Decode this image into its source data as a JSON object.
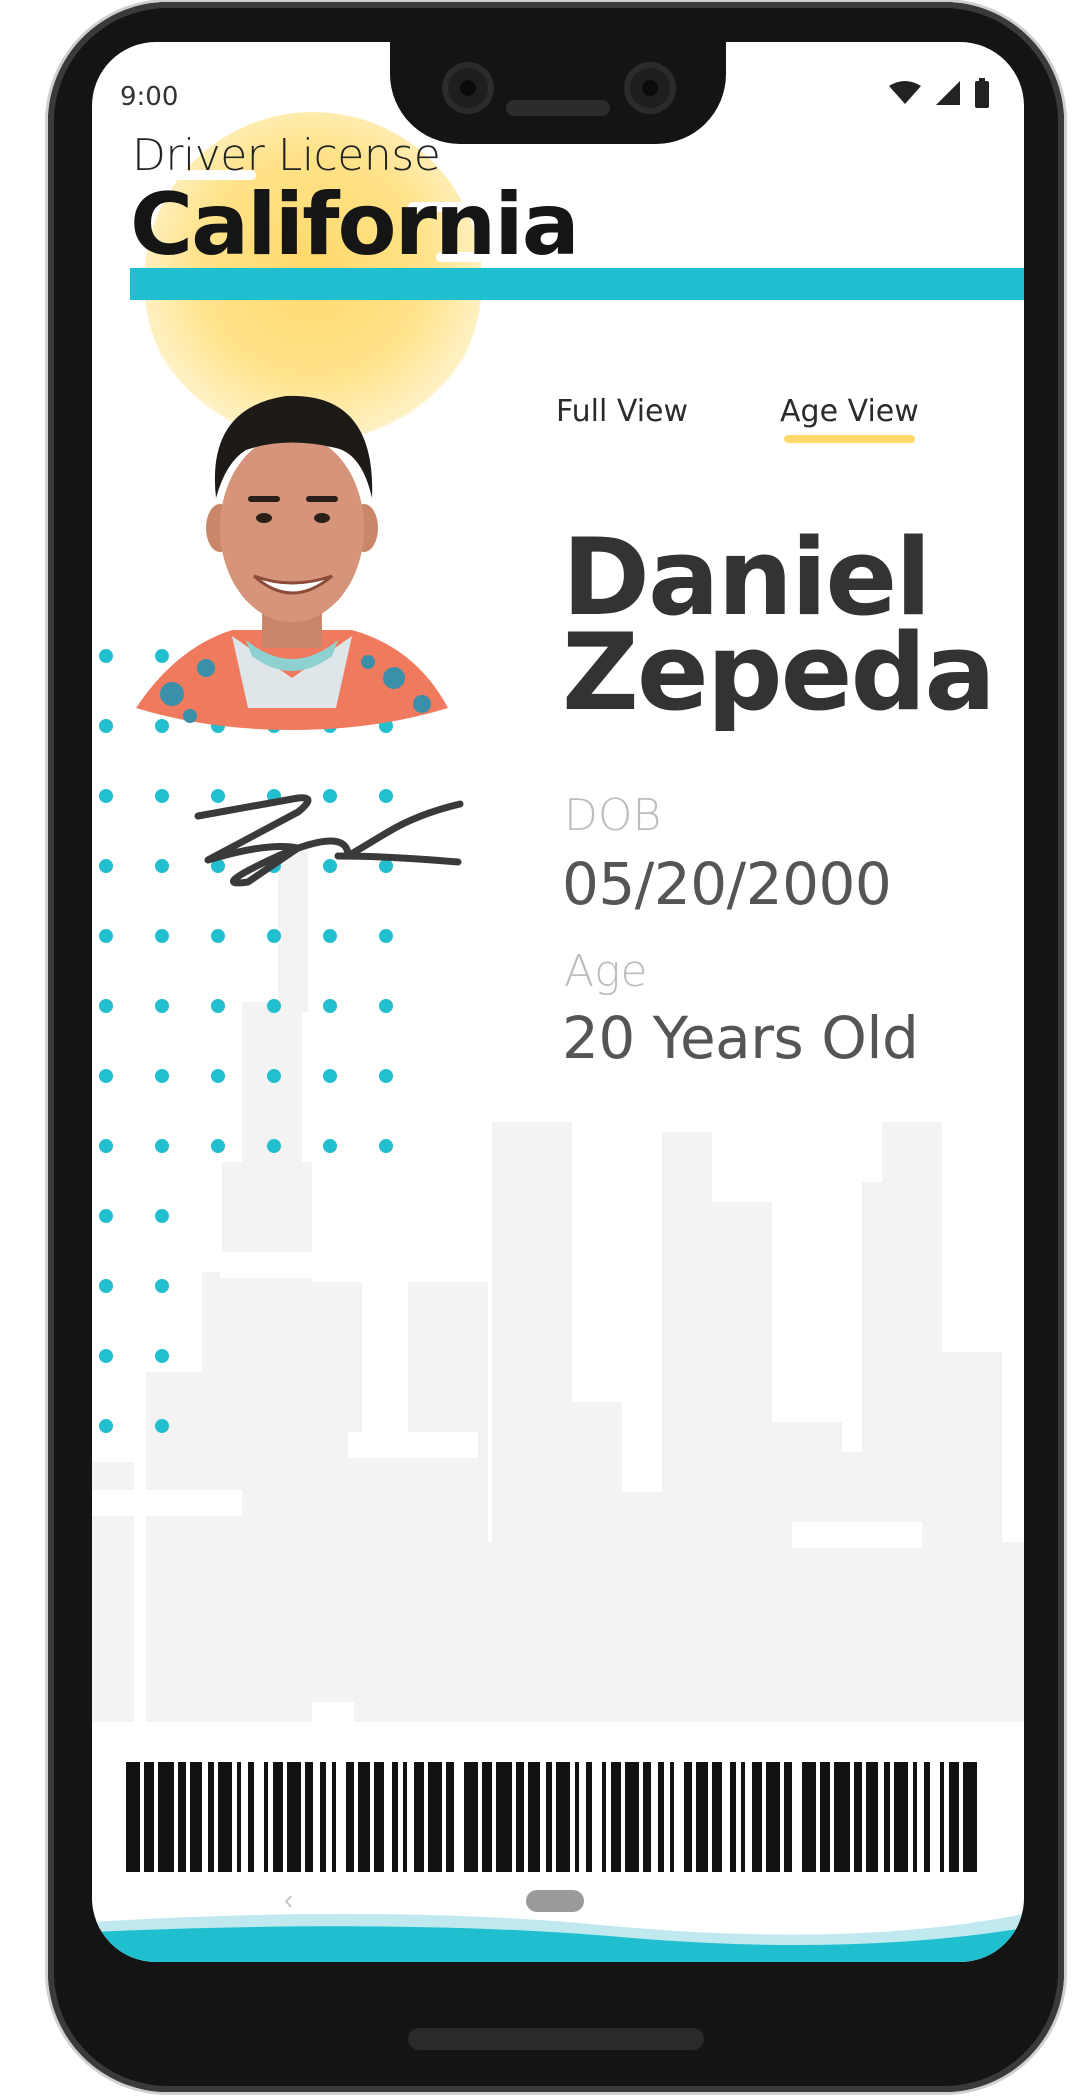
{
  "status_bar": {
    "time": "9:00"
  },
  "header": {
    "subtitle": "Driver License",
    "title": "California"
  },
  "tabs": [
    {
      "label": "Full View",
      "active": false
    },
    {
      "label": "Age View",
      "active": true
    }
  ],
  "person": {
    "first_name": "Daniel",
    "last_name": "Zepeda",
    "dob_label": "DOB",
    "dob": "05/20/2000",
    "age_label": "Age",
    "age": "20 Years Old"
  },
  "colors": {
    "accent": "#1fbfcf",
    "sun": "#ffd96b",
    "text_dark": "#333333",
    "label_gray": "#bdbdbd"
  },
  "icons": [
    "wifi-icon",
    "signal-icon",
    "battery-icon",
    "back-icon",
    "home-pill-icon"
  ]
}
